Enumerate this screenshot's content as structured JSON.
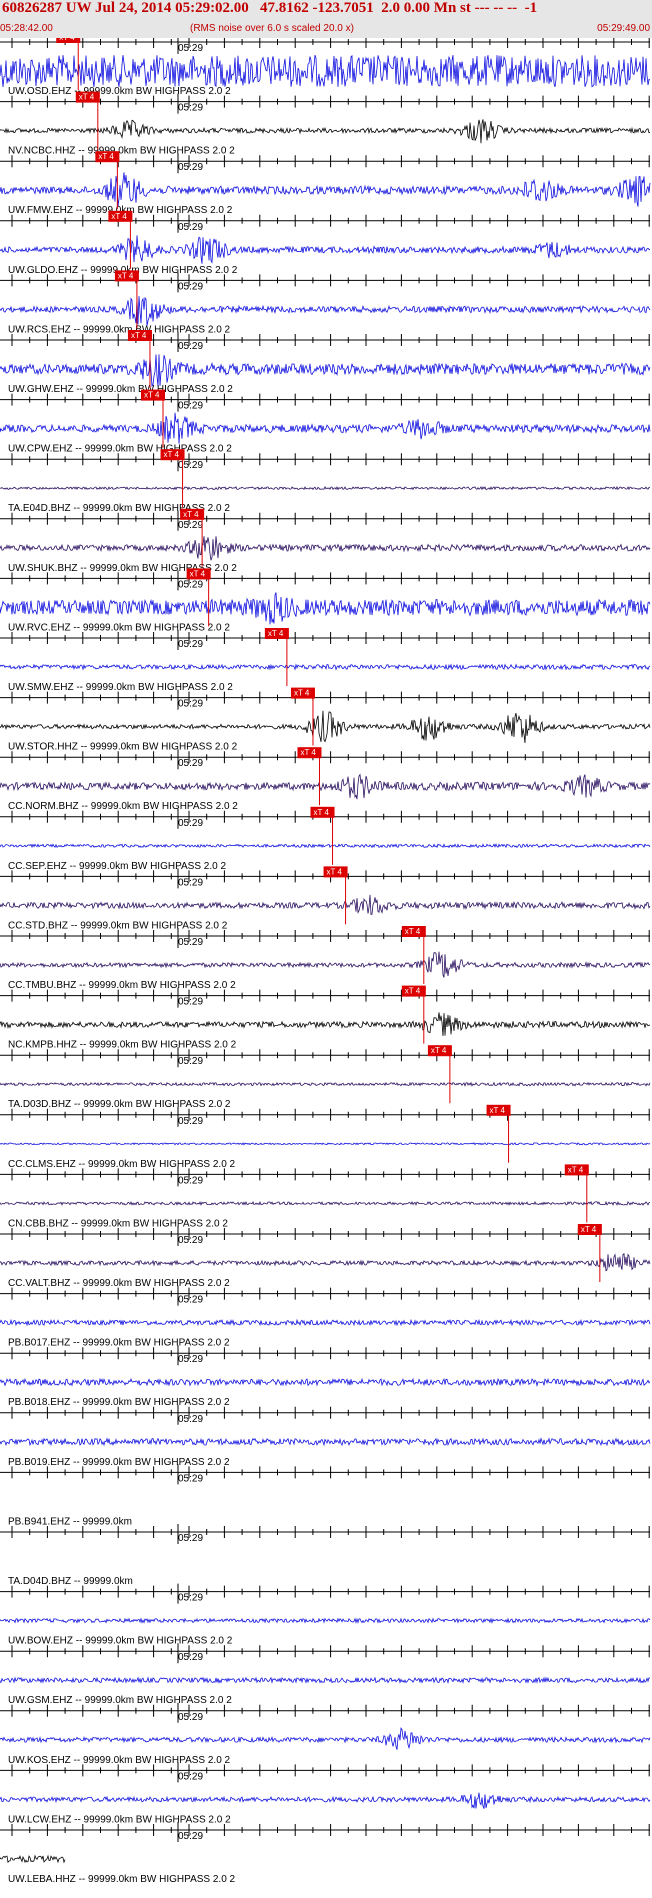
{
  "header": {
    "title": "60826287 UW Jul 24, 2014 05:29:02.00   47.8162 -123.7051  2.0 0.00 Mn st --- -- --  -1",
    "start_time": "05:28:42.00",
    "rms_note": "(RMS noise over 6.0 s scaled 20.0 x)",
    "end_time": "05:29:49.00"
  },
  "pick_label": "xT 4",
  "minute_label": "05:29",
  "colors": {
    "header_bg": "#e6e6e6",
    "title": "#c00000",
    "trace_blue": "#1010e0",
    "trace_black": "#000000",
    "trace_purple": "#2a1060",
    "pick": "#dd0000"
  },
  "traces": [
    {
      "label": "UW.OSD.EHZ -- 99999.0km BW  HIGHPASS  2.0  2",
      "color": "blue",
      "amp": 1.0,
      "pick": 0.12,
      "bursts": []
    },
    {
      "label": "NV.NCBC.HHZ -- 99999.0km BW  HIGHPASS  2.0  2",
      "color": "black",
      "amp": 0.15,
      "pick": 0.15,
      "bursts": [
        [
          0.2,
          0.5
        ],
        [
          0.74,
          0.7
        ]
      ]
    },
    {
      "label": "UW.FMW.EHZ -- 99999.0km BW  HIGHPASS  2.0  2",
      "color": "blue",
      "amp": 0.25,
      "pick": 0.18,
      "bursts": [
        [
          0.19,
          1.0
        ],
        [
          0.83,
          0.7
        ],
        [
          0.98,
          0.8
        ]
      ]
    },
    {
      "label": "UW.GLDO.EHZ -- 99999.0km BW  HIGHPASS  2.0  2",
      "color": "blue",
      "amp": 0.2,
      "pick": 0.2,
      "bursts": [
        [
          0.21,
          0.7
        ],
        [
          0.32,
          0.8
        ],
        [
          0.85,
          0.4
        ]
      ]
    },
    {
      "label": "UW.RCS.EHZ -- 99999.0km BW  HIGHPASS  2.0  2",
      "color": "blue",
      "amp": 0.2,
      "pick": 0.21,
      "bursts": [
        [
          0.22,
          0.9
        ]
      ]
    },
    {
      "label": "UW.GHW.EHZ -- 99999.0km BW  HIGHPASS  2.0  2",
      "color": "blue",
      "amp": 0.35,
      "pick": 0.23,
      "bursts": [
        [
          0.24,
          0.8
        ]
      ]
    },
    {
      "label": "UW.CPW.EHZ -- 99999.0km BW  HIGHPASS  2.0  2",
      "color": "blue",
      "amp": 0.25,
      "pick": 0.25,
      "bursts": [
        [
          0.27,
          0.8
        ],
        [
          0.65,
          0.5
        ]
      ]
    },
    {
      "label": "TA.E04D.BHZ -- 99999.0km BW  HIGHPASS  2.0  2",
      "color": "purple",
      "amp": 0.08,
      "pick": 0.28,
      "bursts": []
    },
    {
      "label": "UW.SHUK.BHZ -- 99999.0km BW  HIGHPASS  2.0  2",
      "color": "purple",
      "amp": 0.2,
      "pick": 0.31,
      "bursts": [
        [
          0.32,
          0.8
        ]
      ]
    },
    {
      "label": "UW.RVC.EHZ -- 99999.0km BW  HIGHPASS  2.0  2",
      "color": "blue",
      "amp": 0.5,
      "pick": 0.32,
      "bursts": [
        [
          0.42,
          0.6
        ]
      ]
    },
    {
      "label": "UW.SMW.EHZ -- 99999.0km BW  HIGHPASS  2.0  2",
      "color": "blue",
      "amp": 0.15,
      "pick": 0.44,
      "bursts": []
    },
    {
      "label": "UW.STOR.HHZ -- 99999.0km BW  HIGHPASS  2.0  2",
      "color": "black",
      "amp": 0.15,
      "pick": 0.48,
      "bursts": [
        [
          0.5,
          0.9
        ],
        [
          0.66,
          0.8
        ],
        [
          0.8,
          1.0
        ]
      ]
    },
    {
      "label": "CC.NORM.BHZ -- 99999.0km BW  HIGHPASS  2.0  2",
      "color": "purple",
      "amp": 0.25,
      "pick": 0.49,
      "bursts": [
        [
          0.55,
          0.6
        ],
        [
          0.9,
          0.5
        ]
      ]
    },
    {
      "label": "CC.SEP.EHZ -- 99999.0km BW  HIGHPASS  2.0  2",
      "color": "blue",
      "amp": 0.1,
      "pick": 0.51,
      "bursts": []
    },
    {
      "label": "CC.STD.BHZ -- 99999.0km BW  HIGHPASS  2.0  2",
      "color": "purple",
      "amp": 0.2,
      "pick": 0.53,
      "bursts": [
        [
          0.57,
          0.5
        ]
      ]
    },
    {
      "label": "CC.TMBU.BHZ -- 99999.0km BW  HIGHPASS  2.0  2",
      "color": "purple",
      "amp": 0.15,
      "pick": 0.65,
      "bursts": [
        [
          0.68,
          0.8
        ]
      ]
    },
    {
      "label": "NC.KMPB.HHZ -- 99999.0km BW  HIGHPASS  2.0  2",
      "color": "black",
      "amp": 0.2,
      "pick": 0.65,
      "bursts": [
        [
          0.68,
          0.6
        ]
      ]
    },
    {
      "label": "TA.D03D.BHZ -- 99999.0km BW  HIGHPASS  2.0  2",
      "color": "purple",
      "amp": 0.1,
      "pick": 0.69,
      "bursts": []
    },
    {
      "label": "CC.CLMS.EHZ -- 99999.0km BW  HIGHPASS  2.0  2",
      "color": "blue",
      "amp": 0.06,
      "pick": 0.78,
      "bursts": []
    },
    {
      "label": "CN.CBB.BHZ -- 99999.0km BW  HIGHPASS  2.0  2",
      "color": "purple",
      "amp": 0.1,
      "pick": 0.9,
      "bursts": []
    },
    {
      "label": "CC.VALT.BHZ -- 99999.0km BW  HIGHPASS  2.0  2",
      "color": "purple",
      "amp": 0.15,
      "pick": 0.92,
      "bursts": [
        [
          0.95,
          0.6
        ]
      ]
    },
    {
      "label": "PB.B017.EHZ -- 99999.0km BW  HIGHPASS  2.0  2",
      "color": "blue",
      "amp": 0.15,
      "pick": null,
      "bursts": []
    },
    {
      "label": "PB.B018.EHZ -- 99999.0km BW  HIGHPASS  2.0  2",
      "color": "blue",
      "amp": 0.2,
      "pick": null,
      "bursts": []
    },
    {
      "label": "PB.B019.EHZ -- 99999.0km BW  HIGHPASS  2.0  2",
      "color": "blue",
      "amp": 0.2,
      "pick": null,
      "bursts": []
    },
    {
      "label": "PB.B941.EHZ -- 99999.0km",
      "color": "none",
      "amp": 0,
      "pick": null,
      "bursts": []
    },
    {
      "label": "TA.D04D.BHZ -- 99999.0km",
      "color": "none",
      "amp": 0,
      "pick": null,
      "bursts": []
    },
    {
      "label": "UW.BOW.EHZ -- 99999.0km BW  HIGHPASS  2.0  2",
      "color": "blue",
      "amp": 0.12,
      "pick": null,
      "bursts": []
    },
    {
      "label": "UW.GSM.EHZ -- 99999.0km BW  HIGHPASS  2.0  2",
      "color": "blue",
      "amp": 0.15,
      "pick": null,
      "bursts": []
    },
    {
      "label": "UW.KOS.EHZ -- 99999.0km BW  HIGHPASS  2.0  2",
      "color": "blue",
      "amp": 0.15,
      "pick": null,
      "bursts": [
        [
          0.62,
          0.6
        ]
      ]
    },
    {
      "label": "UW.LCW.EHZ -- 99999.0km BW  HIGHPASS  2.0  2",
      "color": "blue",
      "amp": 0.15,
      "pick": null,
      "bursts": [
        [
          0.74,
          0.5
        ]
      ]
    },
    {
      "label": "UW.LEBA.HHZ -- 99999.0km BW  HIGHPASS  2.0  2",
      "color": "black",
      "amp": 0.2,
      "pick": null,
      "bursts": [],
      "partial": 0.1
    }
  ]
}
